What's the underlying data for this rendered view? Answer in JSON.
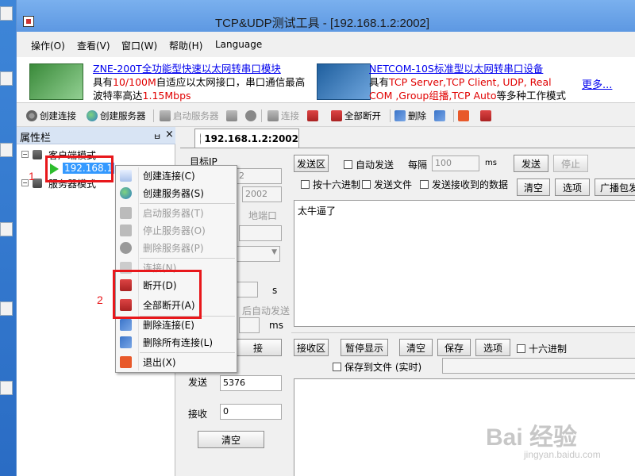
{
  "window": {
    "title": "TCP&UDP测试工具 - [192.168.1.2:2002]"
  },
  "menu": [
    {
      "label": "操作(O)"
    },
    {
      "label": "查看(V)"
    },
    {
      "label": "窗口(W)"
    },
    {
      "label": "帮助(H)"
    },
    {
      "label": "Language"
    }
  ],
  "ads": {
    "ad1": {
      "link": "ZNE-200T全功能型快速以太网转串口模块",
      "line2a": "具有",
      "line2b": "10/100M",
      "line2c": "自适应以太网接口，串口通信最高",
      "line3a": "波特率高达",
      "line3b": "1.15Mbps"
    },
    "ad2": {
      "link": "NETCOM-10S标准型以太网转串口设备",
      "line2a": "具有",
      "line2b": "TCP Server,TCP Client, UDP, Real",
      "line3a": "COM ,Group组播,TCP Auto",
      "line3b": "等多种工作模式"
    },
    "more": "更多..."
  },
  "toolbar": {
    "create_connection": "创建连接",
    "create_server": "创建服务器",
    "start_server": "启动服务器",
    "connect": "连接",
    "disconnect_all": "全部断开",
    "delete": "删除"
  },
  "panel": {
    "title": "属性栏",
    "pin": "ㅂ",
    "close": "×",
    "client_mode": "客户端模式",
    "selected_node": "192.168.1",
    "server_mode": "服务器模式"
  },
  "tab": {
    "label": "192.168.1.2:2002"
  },
  "connection": {
    "target_ip_label": "目标IP",
    "ip_partial": "2",
    "port_value": "2002",
    "local_port_label": "地端口",
    "interval_suffix": "s",
    "auto_send_label": "后自动发送",
    "ms_label": "ms",
    "connect_btn_partial": "接",
    "send_label": "发送",
    "send_count": "5376",
    "recv_label": "接收",
    "recv_count": "0",
    "clear_btn": "清空"
  },
  "send_area": {
    "title": "发送区",
    "auto_send": "自动发送",
    "interval_label": "每隔",
    "interval_value": "100",
    "interval_unit": "ms",
    "send_btn": "发送",
    "stop_btn": "停止",
    "hex_send": "按十六进制",
    "send_file": "发送文件",
    "send_received": "发送接收到的数据",
    "clear_btn": "清空",
    "options_btn": "选项",
    "broadcast_btn": "广播包发",
    "content": "太牛逼了"
  },
  "recv_area": {
    "title": "接收区",
    "pause_btn": "暂停显示",
    "clear_btn": "清空",
    "save_btn": "保存",
    "options_btn": "选项",
    "hex_label": "十六进制",
    "save_to_file": "保存到文件 (实时)"
  },
  "context_menu": [
    {
      "label": "创建连接(C)",
      "enabled": true
    },
    {
      "label": "创建服务器(S)",
      "enabled": true
    },
    {
      "label": "启动服务器(T)",
      "enabled": false
    },
    {
      "label": "停止服务器(O)",
      "enabled": false
    },
    {
      "label": "删除服务器(P)",
      "enabled": false
    },
    {
      "label": "连接(N)",
      "enabled": false
    },
    {
      "label": "断开(D)",
      "enabled": true
    },
    {
      "label": "全部断开(A)",
      "enabled": true
    },
    {
      "label": "删除连接(E)",
      "enabled": true
    },
    {
      "label": "删除所有连接(L)",
      "enabled": true
    },
    {
      "label": "退出(X)",
      "enabled": true
    }
  ],
  "annotations": {
    "step1": "1",
    "step2": "2"
  },
  "watermark": {
    "brand": "Bai 经验",
    "url": "jingyan.baidu.com"
  },
  "colors": {
    "accent": "#3399ff",
    "highlight_box": "#e8171b",
    "ad_red": "#e00000",
    "link_blue": "#0000ee"
  }
}
